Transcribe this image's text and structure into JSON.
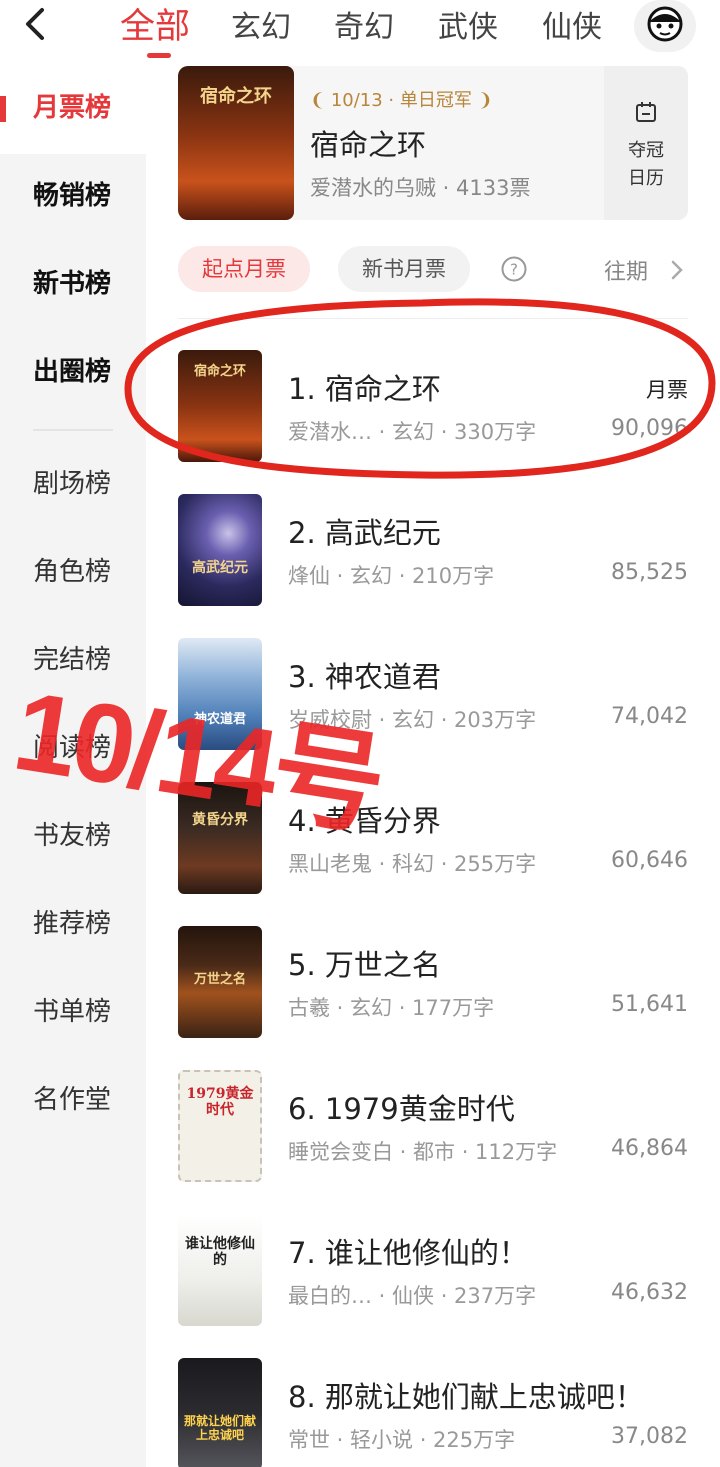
{
  "nav": {
    "tabs": [
      {
        "label": "全部",
        "active": true
      },
      {
        "label": "玄幻"
      },
      {
        "label": "奇幻"
      },
      {
        "label": "武侠"
      },
      {
        "label": "仙侠"
      }
    ]
  },
  "sidebar": {
    "items": [
      {
        "label": "月票榜",
        "active": true
      },
      {
        "label": "畅销榜"
      },
      {
        "label": "新书榜"
      },
      {
        "label": "出圈榜"
      },
      {
        "label": "剧场榜"
      },
      {
        "label": "角色榜"
      },
      {
        "label": "完结榜"
      },
      {
        "label": "阅读榜"
      },
      {
        "label": "书友榜"
      },
      {
        "label": "推荐榜"
      },
      {
        "label": "书单榜"
      },
      {
        "label": "名作堂"
      }
    ]
  },
  "champion": {
    "badge": "10/13 · 单日冠军",
    "title": "宿命之环",
    "meta": "爱潜水的乌贼 · 4133票",
    "calendar_label_1": "夺冠",
    "calendar_label_2": "日历",
    "cover_text": "宿命之环"
  },
  "filters": {
    "chip_active": "起点月票",
    "chip_new": "新书月票",
    "past": "往期"
  },
  "list": {
    "column_label": "月票",
    "rows": [
      {
        "title": "1. 宿命之环",
        "meta": "爱潜水…   · 玄幻 · 330万字",
        "votes": "90,096",
        "cover_text": "宿命之环",
        "cover_color": "#6b2a10"
      },
      {
        "title": "2. 高武纪元",
        "meta": "烽仙 · 玄幻 · 210万字",
        "votes": "85,525",
        "cover_text": "高武纪元",
        "cover_color": "#2b2a5e"
      },
      {
        "title": "3. 神农道君",
        "meta": "岁威校尉 · 玄幻 · 203万字",
        "votes": "74,042",
        "cover_text": "神农道君",
        "cover_color": "#4f7fb8"
      },
      {
        "title": "4. 黄昏分界",
        "meta": "黑山老鬼 · 科幻 · 255万字",
        "votes": "60,646",
        "cover_text": "黄昏分界",
        "cover_color": "#3a2a22"
      },
      {
        "title": "5. 万世之名",
        "meta": "古羲 · 玄幻 · 177万字",
        "votes": "51,641",
        "cover_text": "万世之名",
        "cover_color": "#4a2a18"
      },
      {
        "title": "6. 1979黄金时代",
        "meta": "睡觉会变白 · 都市 · 112万字",
        "votes": "46,864",
        "cover_text": "1979黄金时代",
        "cover_color": "#f3f0e8"
      },
      {
        "title": "7. 谁让他修仙的！",
        "meta": "最白的…   · 仙侠 · 237万字",
        "votes": "46,632",
        "cover_text": "谁让他修仙的",
        "cover_color": "#eeeeea"
      },
      {
        "title": "8. 那就让她们献上忠诚吧！",
        "meta": "常世 · 轻小说 · 225万字",
        "votes": "37,082",
        "cover_text": "那就让她们献上忠诚吧",
        "cover_color": "#2c2c30"
      }
    ]
  },
  "annotation": {
    "overlay_text": "10/14号"
  },
  "colors": {
    "accent": "#e5383b",
    "gold": "#b8863a"
  }
}
